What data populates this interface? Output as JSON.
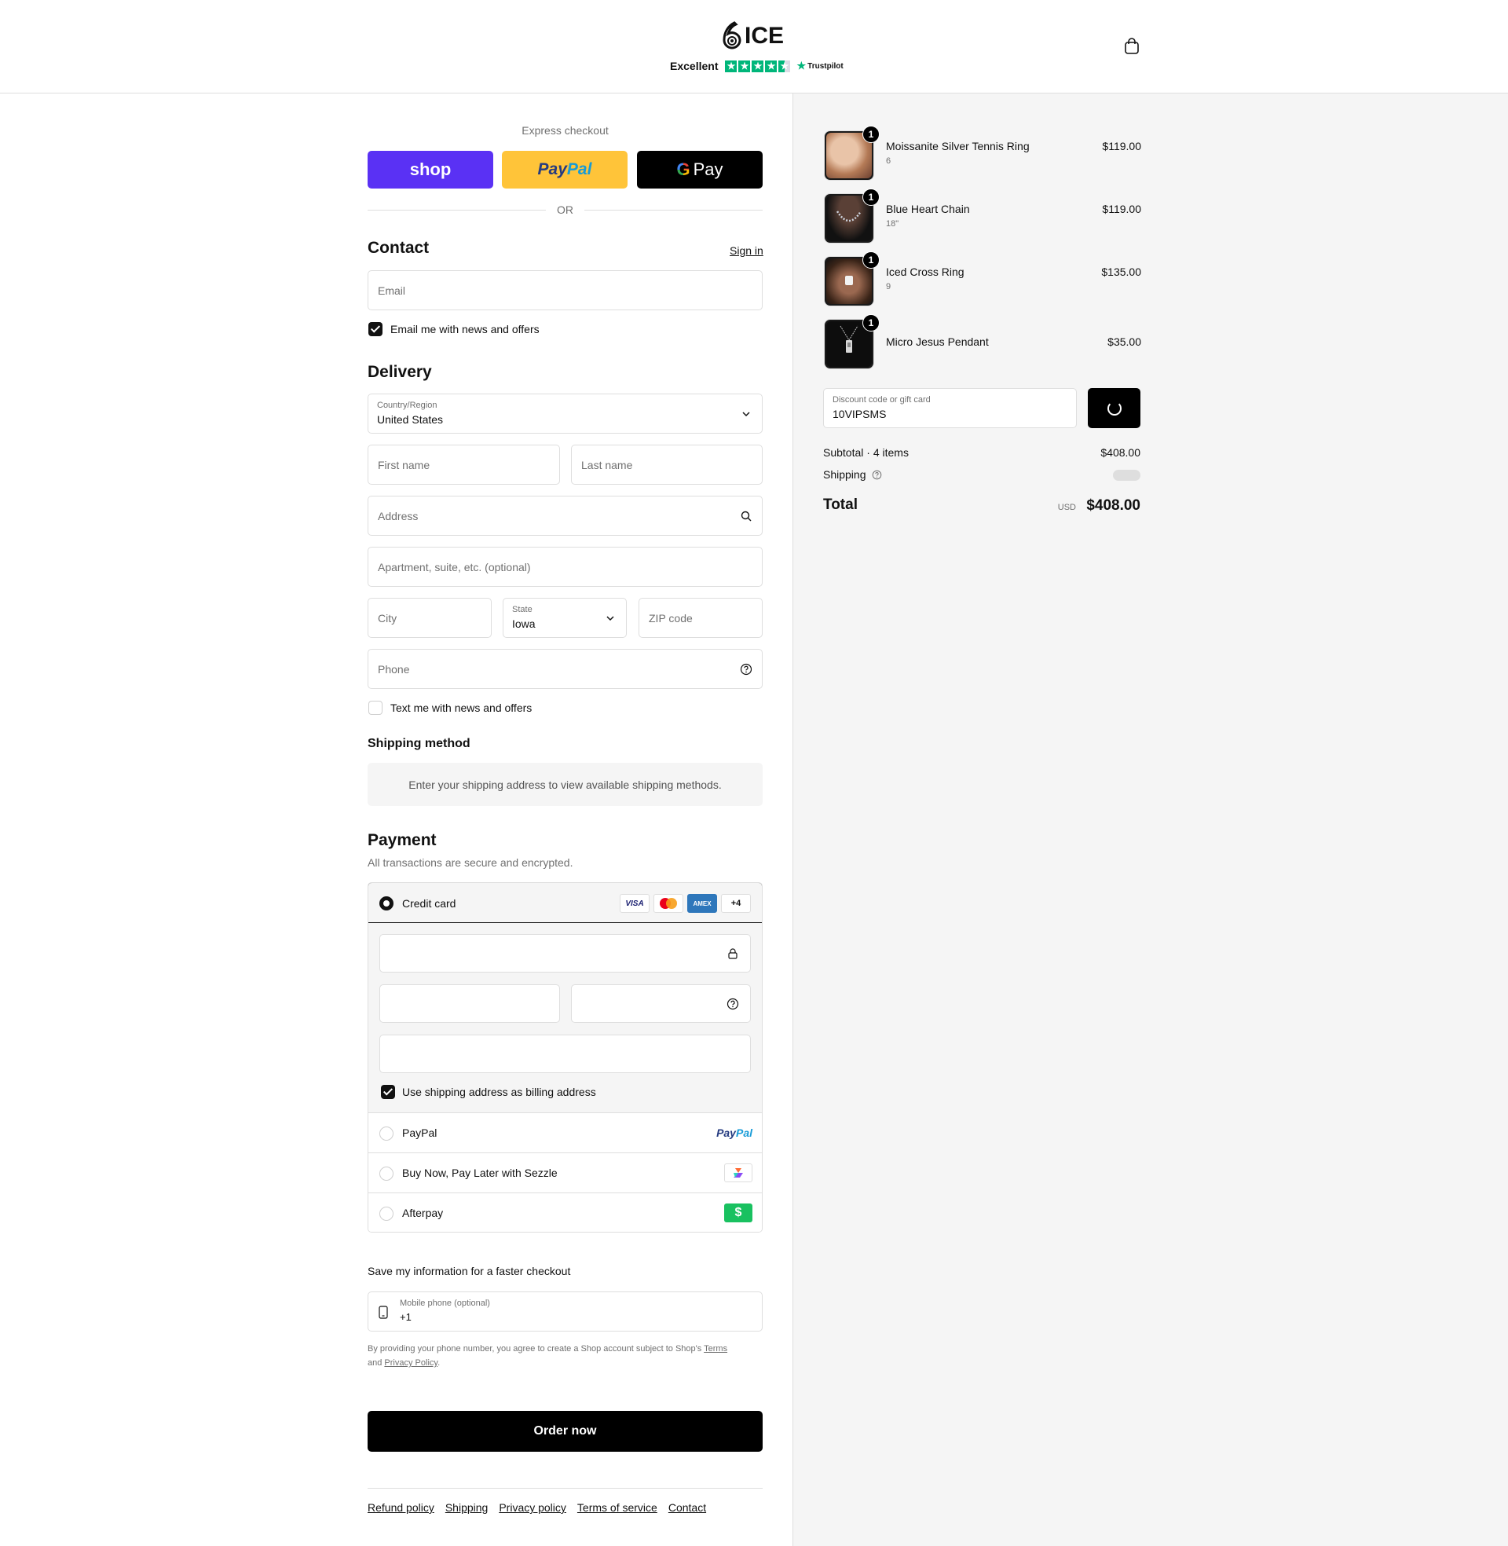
{
  "header": {
    "logo_text": "ICE",
    "logo_mark": "6",
    "trust_label": "Excellent",
    "trust_brand": "Trustpilot",
    "trust_rating": 4.5,
    "cart_icon": "shopping-bag-icon"
  },
  "express": {
    "title": "Express checkout",
    "shop_label": "shop",
    "paypal_part1": "Pay",
    "paypal_part2": "Pal",
    "gpay_g": "G",
    "gpay_label": "Pay",
    "or_label": "OR"
  },
  "contact": {
    "heading": "Contact",
    "sign_in": "Sign in",
    "email_placeholder": "Email",
    "news_checkbox_label": "Email me with news and offers",
    "news_checked": true
  },
  "delivery": {
    "heading": "Delivery",
    "country_label": "Country/Region",
    "country_value": "United States",
    "first_name_placeholder": "First name",
    "last_name_placeholder": "Last name",
    "address_placeholder": "Address",
    "apartment_placeholder": "Apartment, suite, etc. (optional)",
    "city_placeholder": "City",
    "state_label": "State",
    "state_value": "Iowa",
    "zip_placeholder": "ZIP code",
    "phone_placeholder": "Phone",
    "text_checkbox_label": "Text me with news and offers",
    "text_checked": false
  },
  "shipping": {
    "heading": "Shipping method",
    "message": "Enter your shipping address to view available shipping methods."
  },
  "payment": {
    "heading": "Payment",
    "subtitle": "All transactions are secure and encrypted.",
    "credit_card_label": "Credit card",
    "card_logos": [
      "VISA",
      "mastercard",
      "AMEX",
      "+4"
    ],
    "billing_checkbox_label": "Use shipping address as billing address",
    "billing_checked": true,
    "paypal_label": "PayPal",
    "paypal_logo_1": "Pay",
    "paypal_logo_2": "Pal",
    "sezzle_label": "Buy Now, Pay Later with Sezzle",
    "afterpay_label": "Afterpay",
    "afterpay_logo": "$"
  },
  "save_info": {
    "heading": "Save my information for a faster checkout",
    "mobile_label": "Mobile phone (optional)",
    "mobile_value": "+1",
    "disclaimer_1": "By providing your phone number, you agree to create a Shop account subject to Shop's",
    "terms_link": "Terms",
    "disclaimer_and": "and",
    "privacy_link": "Privacy Policy",
    "disclaimer_end": "."
  },
  "order_button": "Order now",
  "footer": {
    "links": [
      "Refund policy",
      "Shipping",
      "Privacy policy",
      "Terms of service",
      "Contact"
    ]
  },
  "summary": {
    "items": [
      {
        "name": "Moissanite Silver Tennis Ring",
        "variant": "6",
        "price": "$119.00",
        "qty": "1"
      },
      {
        "name": "Blue Heart Chain",
        "variant": "18\"",
        "price": "$119.00",
        "qty": "1"
      },
      {
        "name": "Iced Cross Ring",
        "variant": "9",
        "price": "$135.00",
        "qty": "1"
      },
      {
        "name": "Micro Jesus Pendant",
        "variant": "",
        "price": "$35.00",
        "qty": "1"
      }
    ],
    "discount_label": "Discount code or gift card",
    "discount_value": "10VIPSMS",
    "subtotal_label": "Subtotal · 4 items",
    "subtotal_value": "$408.00",
    "shipping_label": "Shipping",
    "total_label": "Total",
    "currency": "USD",
    "total_value": "$408.00"
  }
}
